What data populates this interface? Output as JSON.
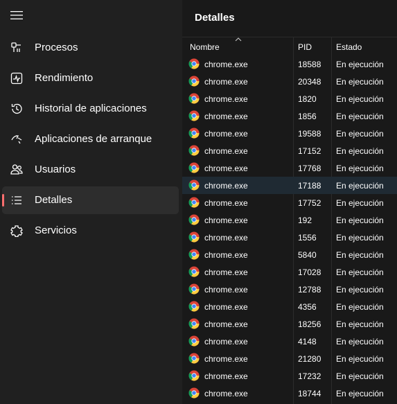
{
  "sidebar": {
    "items": [
      {
        "label": "Procesos",
        "icon": "processes-icon",
        "active": false
      },
      {
        "label": "Rendimiento",
        "icon": "performance-icon",
        "active": false
      },
      {
        "label": "Historial de aplicaciones",
        "icon": "history-icon",
        "active": false
      },
      {
        "label": "Aplicaciones de arranque",
        "icon": "startup-icon",
        "active": false
      },
      {
        "label": "Usuarios",
        "icon": "users-icon",
        "active": false
      },
      {
        "label": "Detalles",
        "icon": "details-icon",
        "active": true
      },
      {
        "label": "Servicios",
        "icon": "services-icon",
        "active": false
      }
    ]
  },
  "main": {
    "title": "Detalles",
    "columns": {
      "name": "Nombre",
      "pid": "PID",
      "state": "Estado"
    },
    "selected_row": 7,
    "rows": [
      {
        "name": "chrome.exe",
        "pid": "18588",
        "state": "En ejecución"
      },
      {
        "name": "chrome.exe",
        "pid": "20348",
        "state": "En ejecución"
      },
      {
        "name": "chrome.exe",
        "pid": "1820",
        "state": "En ejecución"
      },
      {
        "name": "chrome.exe",
        "pid": "1856",
        "state": "En ejecución"
      },
      {
        "name": "chrome.exe",
        "pid": "19588",
        "state": "En ejecución"
      },
      {
        "name": "chrome.exe",
        "pid": "17152",
        "state": "En ejecución"
      },
      {
        "name": "chrome.exe",
        "pid": "17768",
        "state": "En ejecución"
      },
      {
        "name": "chrome.exe",
        "pid": "17188",
        "state": "En ejecución"
      },
      {
        "name": "chrome.exe",
        "pid": "17752",
        "state": "En ejecución"
      },
      {
        "name": "chrome.exe",
        "pid": "192",
        "state": "En ejecución"
      },
      {
        "name": "chrome.exe",
        "pid": "1556",
        "state": "En ejecución"
      },
      {
        "name": "chrome.exe",
        "pid": "5840",
        "state": "En ejecución"
      },
      {
        "name": "chrome.exe",
        "pid": "17028",
        "state": "En ejecución"
      },
      {
        "name": "chrome.exe",
        "pid": "12788",
        "state": "En ejecución"
      },
      {
        "name": "chrome.exe",
        "pid": "4356",
        "state": "En ejecución"
      },
      {
        "name": "chrome.exe",
        "pid": "18256",
        "state": "En ejecución"
      },
      {
        "name": "chrome.exe",
        "pid": "4148",
        "state": "En ejecución"
      },
      {
        "name": "chrome.exe",
        "pid": "21280",
        "state": "En ejecución"
      },
      {
        "name": "chrome.exe",
        "pid": "17232",
        "state": "En ejecución"
      },
      {
        "name": "chrome.exe",
        "pid": "18744",
        "state": "En ejecución"
      }
    ]
  },
  "colors": {
    "sidebar_bg": "#202020",
    "main_bg": "#191919",
    "active_item_bg": "#2d2d2d",
    "active_indicator": "#ff6f6f",
    "selected_row_bg": "#1f2a33"
  }
}
